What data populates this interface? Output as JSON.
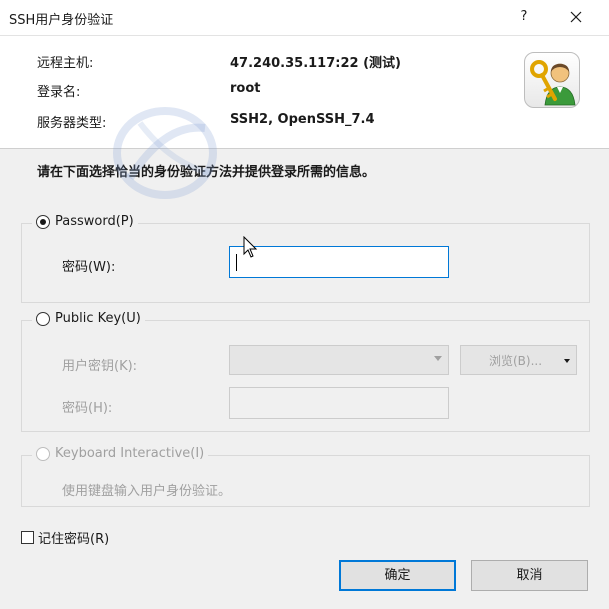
{
  "window": {
    "title": "SSH用户身份验证",
    "help_label": "?"
  },
  "info": {
    "host_label": "远程主机:",
    "host_value": "47.240.35.117:22 (测试)",
    "login_label": "登录名:",
    "login_value": "root",
    "server_type_label": "服务器类型:",
    "server_type_value": "SSH2, OpenSSH_7.4"
  },
  "instruction": "请在下面选择恰当的身份验证方法并提供登录所需的信息。",
  "password_group": {
    "label": "Password(P)",
    "selected": true,
    "password_label": "密码(W):",
    "password_value": ""
  },
  "publickey_group": {
    "label": "Public Key(U)",
    "selected": false,
    "user_key_label": "用户密钥(K):",
    "user_key_value": "",
    "browse_label": "浏览(B)...",
    "passphrase_label": "密码(H):",
    "passphrase_value": ""
  },
  "keyboard_group": {
    "label": "Keyboard Interactive(I)",
    "selected": false,
    "description": "使用键盘输入用户身份验证。"
  },
  "remember_password": {
    "label": "记住密码(R)",
    "checked": false
  },
  "buttons": {
    "ok_label": "确定",
    "cancel_label": "取消"
  },
  "colors": {
    "focus_border": "#0078d7",
    "panel_bg": "#f0f0f0"
  }
}
